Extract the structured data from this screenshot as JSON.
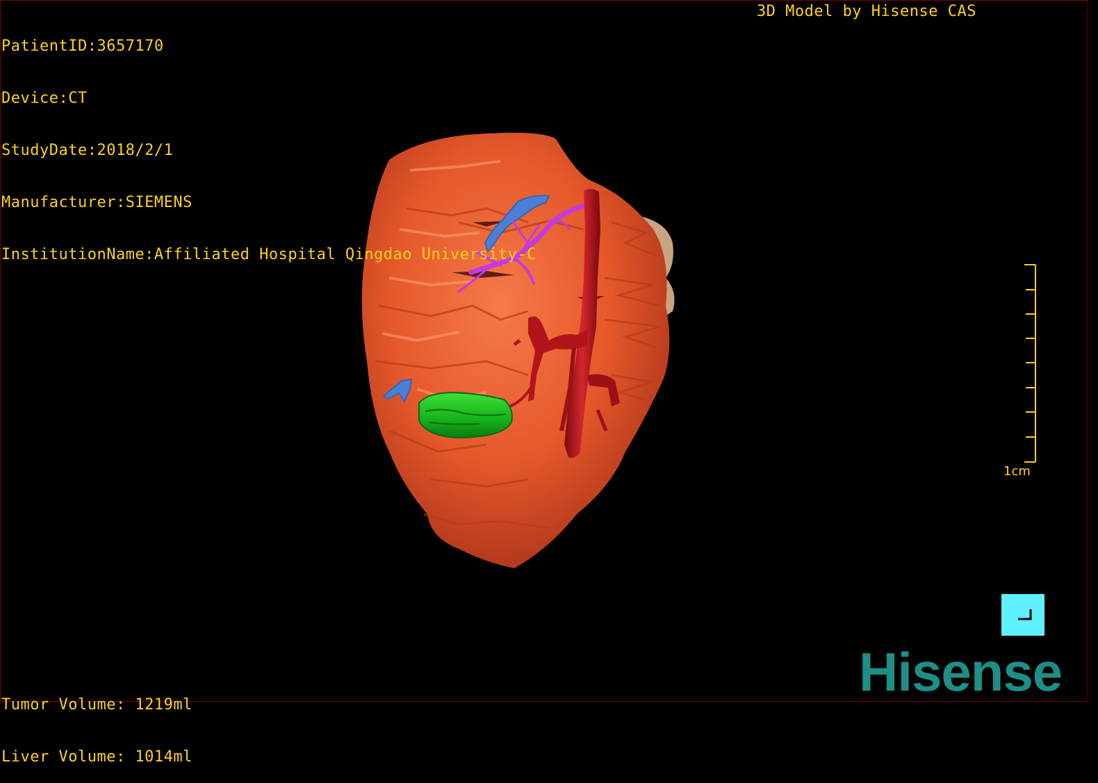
{
  "overlay": {
    "patient_id": "PatientID:3657170",
    "device": "Device:CT",
    "study_date": "StudyDate:2018/2/1",
    "manufacturer": "Manufacturer:SIEMENS",
    "institution": "InstitutionName:Affiliated Hospital Qingdao University-C",
    "model_credit": "3D Model by Hisense CAS"
  },
  "volumes": {
    "tumor": "Tumor Volume: 1219ml",
    "liver": "Liver Volume: 1014ml"
  },
  "scale_bar": {
    "label": "1cm"
  },
  "logo": {
    "text": "Hisense"
  },
  "icons": {
    "corner_button": "corner-icon"
  },
  "colors": {
    "text": "#ffd21a",
    "liver": "#e55a2c",
    "tumor": "#12b21a",
    "artery": "#b3141a",
    "portal_vein": "#c43ae0",
    "hepatic_vein": "#4a7fd6",
    "button": "#5ff0ff",
    "logo": "#1d8f86"
  }
}
